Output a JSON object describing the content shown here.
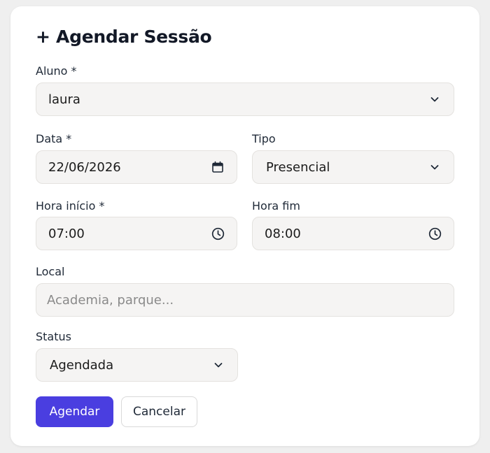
{
  "form": {
    "title": "+ Agendar Sessão",
    "aluno": {
      "label": "Aluno *",
      "value": "laura"
    },
    "data": {
      "label": "Data *",
      "value": "22/06/2026"
    },
    "tipo": {
      "label": "Tipo",
      "value": "Presencial"
    },
    "hora_inicio": {
      "label": "Hora início *",
      "value": "07:00"
    },
    "hora_fim": {
      "label": "Hora fim",
      "value": "08:00"
    },
    "local": {
      "label": "Local",
      "value": "",
      "placeholder": "Academia, parque..."
    },
    "status": {
      "label": "Status",
      "value": "Agendada"
    },
    "actions": {
      "submit_label": "Agendar",
      "cancel_label": "Cancelar"
    }
  },
  "colors": {
    "primary": "#4a3ee0",
    "field_bg": "#f5f4f3",
    "card_bg": "#ffffff",
    "page_bg": "#efefef"
  },
  "icons": {
    "select": "chevron-down-icon",
    "date": "calendar-icon",
    "time": "clock-icon"
  }
}
